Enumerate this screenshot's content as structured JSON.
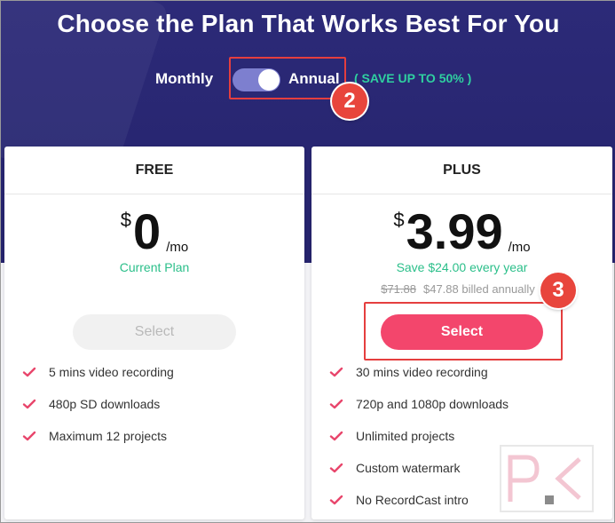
{
  "header": {
    "title": "Choose the Plan That Works Best For You",
    "billing": {
      "monthly_label": "Monthly",
      "annual_label": "Annual",
      "selected": "Annual",
      "save_note": "( SAVE UP TO 50% )"
    }
  },
  "annotations": {
    "step_toggle": "2",
    "step_select": "3"
  },
  "plans": [
    {
      "name": "FREE",
      "currency": "$",
      "amount": "0",
      "period": "/mo",
      "status": "Current Plan",
      "button_label": "Select",
      "features": [
        "5 mins video recording",
        "480p SD downloads",
        "Maximum 12 projects"
      ]
    },
    {
      "name": "PLUS",
      "currency": "$",
      "amount": "3.99",
      "period": "/mo",
      "savings": "Save $24.00 every year",
      "original_price": "$71.88",
      "billed": "$47.88 billed annually",
      "button_label": "Select",
      "features": [
        "30 mins video recording",
        "720p and 1080p downloads",
        "Unlimited projects",
        "Custom watermark",
        "No RecordCast intro"
      ]
    }
  ],
  "colors": {
    "hero_bg": "#2c2a78",
    "accent_green": "#2bbf8a",
    "primary_button": "#f3466c",
    "check": "#e8456b",
    "annotation_red": "#e53e3e"
  }
}
